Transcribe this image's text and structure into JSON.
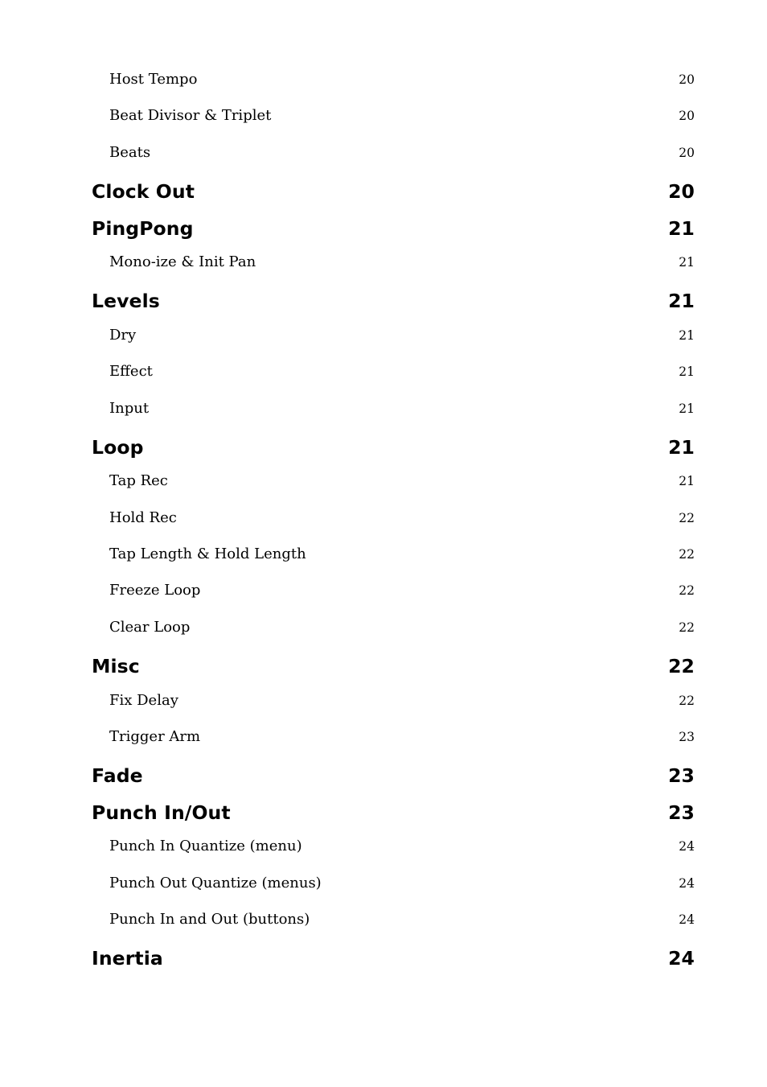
{
  "document": {
    "type": "table-of-contents",
    "background_color": "#ffffff",
    "text_color": "#000000"
  },
  "toc": {
    "entries": [
      {
        "label": "Host Tempo",
        "page": "20",
        "level": 2
      },
      {
        "label": "Beat Divisor & Triplet",
        "page": "20",
        "level": 2
      },
      {
        "label": "Beats",
        "page": "20",
        "level": 2
      },
      {
        "label": "Clock Out",
        "page": "20",
        "level": 1
      },
      {
        "label": "PingPong",
        "page": "21",
        "level": 1
      },
      {
        "label": "Mono-ize & Init Pan",
        "page": "21",
        "level": 2
      },
      {
        "label": "Levels",
        "page": "21",
        "level": 1
      },
      {
        "label": "Dry",
        "page": "21",
        "level": 2
      },
      {
        "label": "Effect",
        "page": "21",
        "level": 2
      },
      {
        "label": "Input",
        "page": "21",
        "level": 2
      },
      {
        "label": "Loop",
        "page": "21",
        "level": 1
      },
      {
        "label": "Tap Rec",
        "page": "21",
        "level": 2
      },
      {
        "label": "Hold Rec",
        "page": "22",
        "level": 2
      },
      {
        "label": "Tap Length & Hold Length",
        "page": "22",
        "level": 2
      },
      {
        "label": "Freeze Loop",
        "page": "22",
        "level": 2
      },
      {
        "label": "Clear Loop",
        "page": "22",
        "level": 2
      },
      {
        "label": "Misc",
        "page": "22",
        "level": 1
      },
      {
        "label": "Fix Delay",
        "page": "22",
        "level": 2
      },
      {
        "label": "Trigger Arm",
        "page": "23",
        "level": 2
      },
      {
        "label": "Fade",
        "page": "23",
        "level": 1
      },
      {
        "label": "Punch In/Out",
        "page": "23",
        "level": 1
      },
      {
        "label": "Punch In Quantize (menu)",
        "page": "24",
        "level": 2
      },
      {
        "label": "Punch Out Quantize (menus)",
        "page": "24",
        "level": 2
      },
      {
        "label": "Punch In and Out (buttons)",
        "page": "24",
        "level": 2
      },
      {
        "label": "Inertia",
        "page": "24",
        "level": 1
      }
    ]
  }
}
